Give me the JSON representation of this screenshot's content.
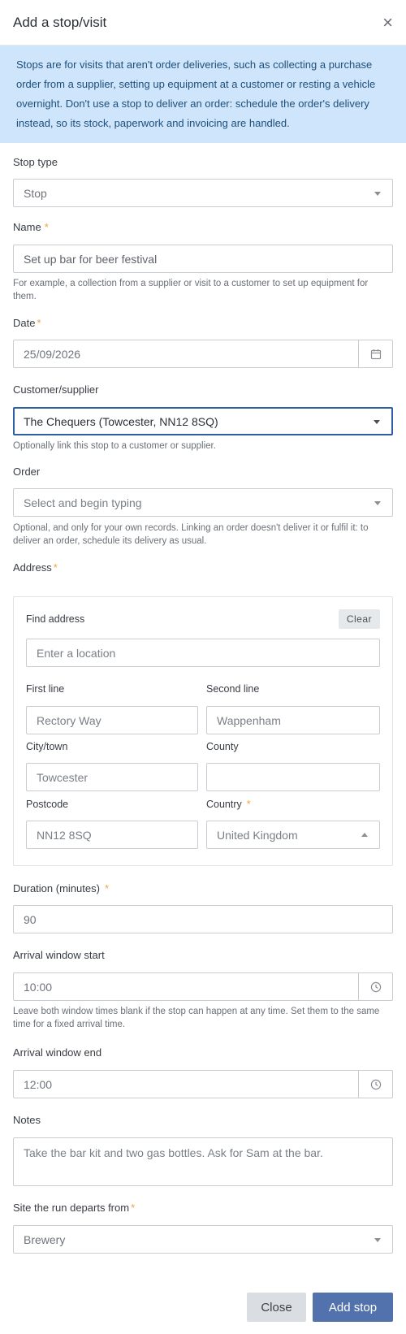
{
  "modal": {
    "title": "Add a stop/visit",
    "info": "Stops are for visits that aren't order deliveries, such as collecting a purchase order from a supplier, setting up equipment at a customer or resting a vehicle overnight. Don't use a stop to deliver an order: schedule the order's delivery instead, so its stock, paperwork and invoicing are handled."
  },
  "stop_type": {
    "label": "Stop type",
    "value": "Stop"
  },
  "name": {
    "label": "Name",
    "value": "Set up bar for beer festival",
    "help": "For example, a collection from a supplier or visit to a customer to set up equipment for them."
  },
  "date": {
    "label": "Date",
    "value": "25/09/2026"
  },
  "customer": {
    "label": "Customer/supplier",
    "value": "The Chequers (Towcester, NN12 8SQ)",
    "help": "Optionally link this stop to a customer or supplier."
  },
  "order": {
    "label": "Order",
    "placeholder": "Select and begin typing",
    "help": "Optional, and only for your own records. Linking an order doesn't deliver it or fulfil it: to deliver an order, schedule its delivery as usual."
  },
  "address": {
    "label": "Address",
    "find_label": "Find address",
    "clear_label": "Clear",
    "find_placeholder": "Enter a location",
    "first_line_label": "First line",
    "first_line": "Rectory Way",
    "second_line_label": "Second line",
    "second_line": "Wappenham",
    "city_label": "City/town",
    "city": "Towcester",
    "county_label": "County",
    "county": "",
    "postcode_label": "Postcode",
    "postcode": "NN12 8SQ",
    "country_label": "Country",
    "country": "United Kingdom"
  },
  "duration": {
    "label": "Duration (minutes)",
    "value": "90"
  },
  "window_start": {
    "label": "Arrival window start",
    "value": "10:00",
    "help": "Leave both window times blank if the stop can happen at any time. Set them to the same time for a fixed arrival time."
  },
  "window_end": {
    "label": "Arrival window end",
    "value": "12:00"
  },
  "notes": {
    "label": "Notes",
    "value": "Take the bar kit and two gas bottles. Ask for Sam at the bar."
  },
  "site": {
    "label": "Site the run departs from",
    "value": "Brewery"
  },
  "buttons": {
    "close": "Close",
    "add": "Add stop"
  },
  "required_marker": "*"
}
